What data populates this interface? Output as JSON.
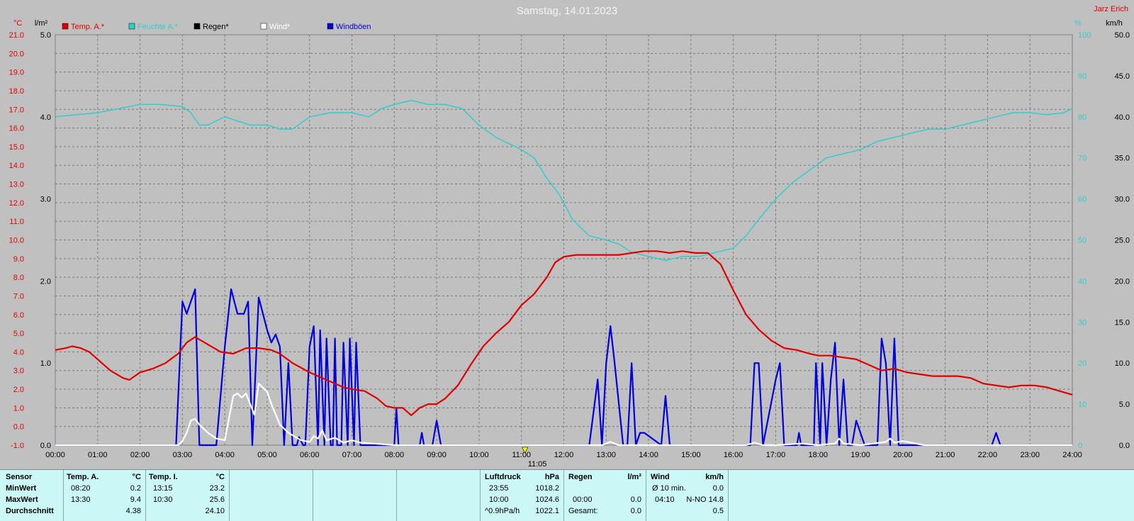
{
  "title": "Samstag, 14.01.2023",
  "author": "Jarz Erich",
  "now_marker": "11:05",
  "colors": {
    "temp": "#e00000",
    "humidity": "#33cccc",
    "rain": "#000000",
    "wind": "#ffffff",
    "gust": "#0000dd"
  },
  "chart_data": {
    "type": "line",
    "x_unit_labels": [
      "°C",
      "l/m²"
    ],
    "right_units": [
      "%",
      "km/h"
    ],
    "x_ticks": [
      "00:00",
      "01:00",
      "02:00",
      "03:00",
      "04:00",
      "05:00",
      "06:00",
      "07:00",
      "08:00",
      "09:00",
      "10:00",
      "11:00",
      "12:00",
      "13:00",
      "14:00",
      "15:00",
      "16:00",
      "17:00",
      "18:00",
      "19:00",
      "20:00",
      "21:00",
      "22:00",
      "23:00",
      "24:00"
    ],
    "temp_ticks": [
      "21.0",
      "20.0",
      "19.0",
      "18.0",
      "17.0",
      "16.0",
      "15.0",
      "14.0",
      "13.0",
      "12.0",
      "11.0",
      "10.0",
      "9.0",
      "8.0",
      "7.0",
      "6.0",
      "5.0",
      "4.0",
      "3.0",
      "2.0",
      "1.0",
      "0.0",
      "-1.0"
    ],
    "rain_ticks": [
      "5.0",
      "4.0",
      "3.0",
      "2.0",
      "1.0",
      "0.0"
    ],
    "humidity_ticks": [
      "100",
      "90",
      "80",
      "70",
      "60",
      "50",
      "40",
      "30",
      "20",
      "10",
      "0"
    ],
    "wind_ticks": [
      "50.0",
      "45.0",
      "40.0",
      "35.0",
      "30.0",
      "25.0",
      "20.0",
      "15.0",
      "10.0",
      "5.0",
      "0.0"
    ],
    "ylim_temp": [
      -1,
      21
    ],
    "ylim_humidity": [
      0,
      100
    ],
    "ylim_wind": [
      0,
      50
    ],
    "grid": true,
    "legend_position": "top-left",
    "series": [
      {
        "name": "Temp. A.*",
        "color_key": "temp",
        "axis": "temp",
        "x": [
          0,
          0.25,
          0.4,
          0.6,
          0.8,
          1,
          1.3,
          1.6,
          1.75,
          2,
          2.3,
          2.6,
          2.9,
          3.1,
          3.3,
          3.6,
          3.9,
          4.2,
          4.5,
          4.8,
          5.1,
          5.3,
          5.6,
          6,
          6.4,
          6.8,
          7,
          7.3,
          7.6,
          7.8,
          8,
          8.2,
          8.4,
          8.6,
          8.8,
          9,
          9.2,
          9.5,
          9.8,
          10.1,
          10.4,
          10.7,
          11,
          11.3,
          11.6,
          11.8,
          12,
          12.3,
          12.6,
          13,
          13.3,
          13.6,
          13.9,
          14.2,
          14.5,
          14.8,
          15.1,
          15.4,
          15.7,
          16,
          16.3,
          16.6,
          16.9,
          17.2,
          17.5,
          17.8,
          18,
          18.3,
          18.6,
          18.9,
          19.2,
          19.5,
          19.8,
          20.1,
          20.4,
          20.7,
          21,
          21.3,
          21.6,
          21.9,
          22.2,
          22.5,
          22.8,
          23.1,
          23.4,
          23.7,
          24
        ],
        "values": [
          4.1,
          4.2,
          4.3,
          4.2,
          4.0,
          3.6,
          3.0,
          2.6,
          2.5,
          2.9,
          3.1,
          3.4,
          3.9,
          4.5,
          4.8,
          4.4,
          4.0,
          3.9,
          4.2,
          4.2,
          4.1,
          3.9,
          3.4,
          2.9,
          2.5,
          2.1,
          2.0,
          1.9,
          1.5,
          1.1,
          1.0,
          1.0,
          0.6,
          1.0,
          1.2,
          1.2,
          1.5,
          2.2,
          3.3,
          4.3,
          5.0,
          5.6,
          6.5,
          7.1,
          8.0,
          8.8,
          9.1,
          9.2,
          9.2,
          9.2,
          9.2,
          9.3,
          9.4,
          9.4,
          9.3,
          9.4,
          9.3,
          9.3,
          8.7,
          7.3,
          6.0,
          5.2,
          4.6,
          4.2,
          4.1,
          3.9,
          3.8,
          3.8,
          3.7,
          3.6,
          3.3,
          3.0,
          3.1,
          2.9,
          2.8,
          2.7,
          2.7,
          2.7,
          2.6,
          2.3,
          2.2,
          2.1,
          2.2,
          2.2,
          2.1,
          1.9,
          1.7
        ]
      },
      {
        "name": "Feuchte A.*",
        "color_key": "humidity",
        "axis": "humidity",
        "x": [
          0,
          0.5,
          1,
          1.5,
          2,
          2.5,
          3,
          3.2,
          3.4,
          3.6,
          4,
          4.3,
          4.6,
          5,
          5.3,
          5.6,
          6,
          6.5,
          7,
          7.4,
          7.7,
          8,
          8.4,
          8.8,
          9.2,
          9.6,
          10,
          10.4,
          10.8,
          11,
          11.3,
          11.6,
          11.9,
          12.2,
          12.6,
          13,
          13.3,
          13.6,
          14,
          14.4,
          14.8,
          15.2,
          15.6,
          16,
          16.3,
          16.6,
          17,
          17.4,
          17.8,
          18.2,
          18.6,
          19,
          19.4,
          19.8,
          20.2,
          20.6,
          21,
          21.4,
          21.8,
          22.2,
          22.6,
          23,
          23.4,
          23.8,
          24
        ],
        "values": [
          80,
          80.5,
          81,
          82,
          83,
          83,
          82.5,
          81,
          78,
          78,
          80,
          79,
          78,
          78,
          77,
          77,
          80,
          81,
          81,
          80,
          82,
          83,
          84,
          83,
          83,
          82,
          78,
          75,
          73,
          72,
          70,
          65,
          61,
          55,
          51,
          50,
          49,
          47,
          46,
          45,
          46,
          46,
          47,
          48,
          51,
          55,
          60,
          64,
          67,
          70,
          71,
          72,
          74,
          75,
          76,
          77,
          77,
          78,
          79,
          80,
          81,
          81,
          80.5,
          81,
          82
        ]
      },
      {
        "name": "Regen*",
        "color_key": "rain",
        "axis": "rain",
        "x": [
          0,
          24
        ],
        "values": [
          0,
          0
        ]
      },
      {
        "name": "Wind*",
        "color_key": "wind",
        "axis": "wind",
        "x": [
          0,
          2.9,
          3,
          3.1,
          3.2,
          3.3,
          3.4,
          3.6,
          3.8,
          4,
          4.2,
          4.3,
          4.4,
          4.5,
          4.6,
          4.7,
          4.8,
          5,
          5.1,
          5.3,
          5.5,
          5.8,
          6,
          6.1,
          6.2,
          6.3,
          6.4,
          6.6,
          6.8,
          7,
          7.2,
          7.5,
          8,
          12.9,
          13.1,
          13.3,
          16.3,
          16.5,
          16.7,
          17,
          17.6,
          18,
          18.4,
          18.5,
          18.6,
          19,
          19.6,
          19.7,
          19.8,
          20,
          20.2,
          20.5,
          24
        ],
        "values": [
          0,
          0,
          0.5,
          1.5,
          3,
          3.2,
          2.5,
          1.5,
          0.8,
          0.6,
          6,
          6.3,
          5.8,
          6.3,
          5,
          3.7,
          7.5,
          6.5,
          5,
          2.5,
          1.5,
          0.6,
          0.4,
          1.1,
          0.8,
          1.8,
          0.6,
          0.9,
          0.3,
          0.6,
          0.3,
          0.2,
          0,
          0,
          0.4,
          0,
          0,
          0.3,
          0,
          0,
          0.2,
          0,
          0.2,
          0.8,
          0.2,
          0,
          0.4,
          0.8,
          0.3,
          0.5,
          0.3,
          0,
          0
        ]
      },
      {
        "name": "Windböen",
        "color_key": "gust",
        "axis": "wind",
        "x": [
          0,
          2.85,
          3,
          3.1,
          3.2,
          3.3,
          3.4,
          3.8,
          4,
          4.15,
          4.3,
          4.45,
          4.55,
          4.65,
          4.8,
          4.9,
          5,
          5.1,
          5.2,
          5.3,
          5.4,
          5.5,
          5.6,
          5.7,
          5.75,
          5.85,
          5.9,
          6,
          6.1,
          6.2,
          6.25,
          6.35,
          6.4,
          6.5,
          6.55,
          6.6,
          6.65,
          6.75,
          6.8,
          6.9,
          6.95,
          7.05,
          7.1,
          7.2,
          7.3,
          7.5,
          7.7,
          8.0,
          8.05,
          8.1,
          8.6,
          8.65,
          8.7,
          8.9,
          9.0,
          9.1,
          12.6,
          12.7,
          12.8,
          12.9,
          13.0,
          13.1,
          13.2,
          13.4,
          13.5,
          13.6,
          13.7,
          13.8,
          13.9,
          14.3,
          14.4,
          14.5,
          16.4,
          16.5,
          16.6,
          16.7,
          17.0,
          17.1,
          17.2,
          17.5,
          17.55,
          17.6,
          17.9,
          17.95,
          18.05,
          18.1,
          18.2,
          18.3,
          18.4,
          18.5,
          18.6,
          18.7,
          18.8,
          18.9,
          19.1,
          19.2,
          19.4,
          19.5,
          19.6,
          19.7,
          19.8,
          19.9,
          20.0,
          20.2,
          22.1,
          22.2,
          22.3,
          24
        ],
        "values": [
          0,
          0,
          17.5,
          16,
          17.5,
          19,
          0,
          0,
          12,
          19,
          16,
          16,
          17.5,
          0,
          18,
          16,
          14,
          12.5,
          13.5,
          12,
          0,
          10,
          0,
          0,
          1,
          0,
          0,
          12,
          14.5,
          0,
          14,
          0,
          13,
          0,
          0,
          13,
          0,
          0,
          12.5,
          0,
          13,
          0,
          12.5,
          0,
          0,
          0,
          0,
          0,
          4.5,
          0,
          0,
          1.5,
          0,
          0,
          3,
          0,
          0,
          4,
          8,
          0,
          10,
          14.5,
          10,
          0,
          0,
          10,
          0,
          1.5,
          1.5,
          0,
          6,
          0,
          0,
          10,
          10,
          0,
          8,
          10,
          0,
          0,
          1.5,
          0,
          0,
          10,
          0,
          10,
          0,
          8,
          12.5,
          0,
          8,
          0,
          0,
          3,
          0,
          0,
          0,
          13,
          10,
          0,
          13,
          0,
          0,
          0,
          0,
          1.5,
          0,
          0
        ]
      }
    ]
  },
  "stats": {
    "sensor_header": "Sensor",
    "row_labels": [
      "MinWert",
      "MaxWert",
      "Durchschnitt"
    ],
    "temp_a": {
      "title": "Temp. A.",
      "unit": "°C",
      "min_time": "08:20",
      "min": "0.2",
      "max_time": "13:30",
      "max": "9.4",
      "avg": "4.38"
    },
    "temp_i": {
      "title": "Temp. I.",
      "unit": "°C",
      "min_time": "13:15",
      "min": "23.2",
      "max_time": "10:30",
      "max": "25.6",
      "avg": "24.10"
    },
    "pressure": {
      "title": "Luftdruck",
      "unit": "hPa",
      "r1_label": "23:55",
      "r1_value": "1018.2",
      "r2_label": "10:00",
      "r2_value": "1024.6",
      "r3_label": "^0.9hPa/h",
      "r3_value": "1022.1"
    },
    "rain": {
      "title": "Regen",
      "unit": "l/m²",
      "r2_label": "00:00",
      "r2_value": "0.0",
      "r3_label": "Gesamt:",
      "r3_value": "0.0"
    },
    "wind": {
      "title": "Wind",
      "unit": "km/h",
      "r1_label": "Ø 10 min.",
      "r1_value": "0.0",
      "r2_label": "04:10",
      "r2_value": "N-NO 14.8",
      "r3_value": "0.5"
    }
  }
}
